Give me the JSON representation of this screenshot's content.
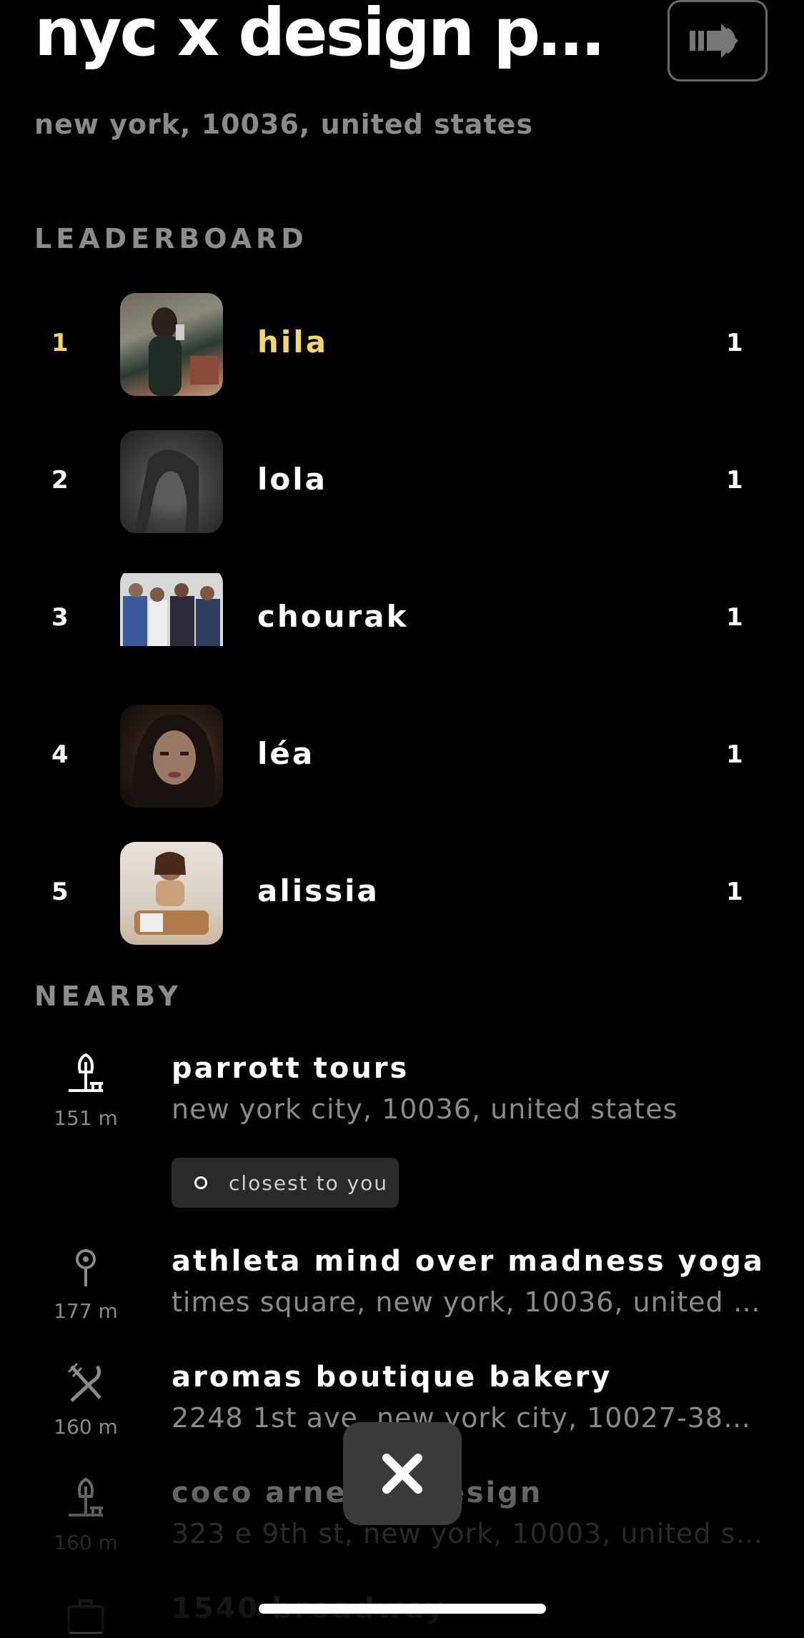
{
  "header": {
    "title": "nyc x design pavili...",
    "subtitle": "new york, 10036, united states"
  },
  "leaderboard": {
    "heading": "LEADERBOARD",
    "entries": [
      {
        "rank": "1",
        "name": "hila",
        "score": "1"
      },
      {
        "rank": "2",
        "name": "lola",
        "score": "1"
      },
      {
        "rank": "3",
        "name": "chourak",
        "score": "1"
      },
      {
        "rank": "4",
        "name": "léa",
        "score": "1"
      },
      {
        "rank": "5",
        "name": "alissia",
        "score": "1"
      }
    ]
  },
  "nearby": {
    "heading": "NEARBY",
    "items": [
      {
        "icon": "park-tree-icon",
        "distance": "151 m",
        "name": "parrott tours",
        "address": "new york city, 10036, united states",
        "badge": "closest to you"
      },
      {
        "icon": "map-pin-icon",
        "distance": "177 m",
        "name": "athleta mind over madness yoga",
        "address": "times square, new york, 10036, united s..."
      },
      {
        "icon": "fork-knife-icon",
        "distance": "160 m",
        "name": "aromas boutique bakery",
        "address": "2248 1st ave, new york city, 10027-3811,..."
      },
      {
        "icon": "park-tree-icon",
        "distance": "160 m",
        "name": "coco arnesen design",
        "address": "323 e 9th st, new york, 10003, united st..."
      },
      {
        "icon": "briefcase-icon",
        "distance": "",
        "name": "1540 broadway",
        "address": ""
      }
    ]
  },
  "colors": {
    "accent_gold": "#f5d66b",
    "muted": "#8a8a8a",
    "background": "#000000"
  }
}
